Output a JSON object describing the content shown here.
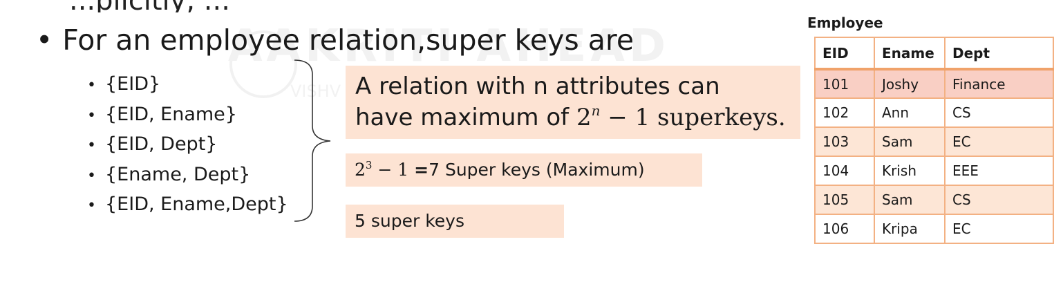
{
  "top_cut_text": "...plicitly, ...",
  "main_bullet": "For an employee relation,super keys are",
  "super_keys": [
    "{EID}",
    "{EID, Ename}",
    "{EID, Dept}",
    "{Ename, Dept}",
    "{EID, Ename,Dept}"
  ],
  "box_main": {
    "line1": "A relation with n attributes can",
    "line2_prefix": "have maximum of ",
    "base": "2",
    "exponent": "n",
    "suffix": " − 1 superkeys."
  },
  "box_calc": {
    "base": "2",
    "exponent": "3",
    "minus": " − 1 ",
    "equals": "=",
    "text": "7 Super keys (Maximum)"
  },
  "box_count": "5 super keys",
  "watermark": "AAKRITI AHEAD",
  "watermark_sub": "VISHV",
  "table": {
    "title": "Employee",
    "headers": [
      "EID",
      "Ename",
      "Dept"
    ],
    "rows": [
      [
        "101",
        "Joshy",
        "Finance"
      ],
      [
        "102",
        "Ann",
        "CS"
      ],
      [
        "103",
        "Sam",
        "EC"
      ],
      [
        "104",
        "Krish",
        "EEE"
      ],
      [
        "105",
        "Sam",
        "CS"
      ],
      [
        "106",
        "Kripa",
        "EC"
      ]
    ]
  },
  "colors": {
    "box_fill": "#fde3d3",
    "table_border": "#f3b183",
    "highlight_row": "#f9cfc4"
  }
}
